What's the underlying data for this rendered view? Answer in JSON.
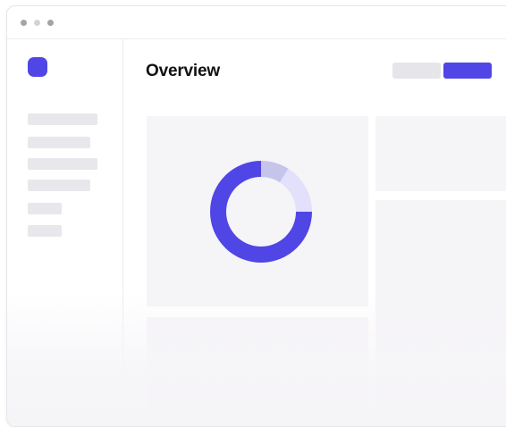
{
  "window": {
    "controls": [
      "close-dot",
      "minimize-dot",
      "maximize-dot"
    ]
  },
  "sidebar": {
    "logo_color": "#4f46e5",
    "placeholder_items": 6
  },
  "main": {
    "title": "Overview",
    "buttons": {
      "secondary_color": "#e6e6ea",
      "primary_color": "#4f46e5"
    }
  },
  "chart_data": {
    "type": "pie",
    "variant": "donut",
    "values": [
      75,
      9,
      16
    ],
    "colors": [
      "#4f46e5",
      "#c7c4ec",
      "#e2e0fa"
    ]
  }
}
